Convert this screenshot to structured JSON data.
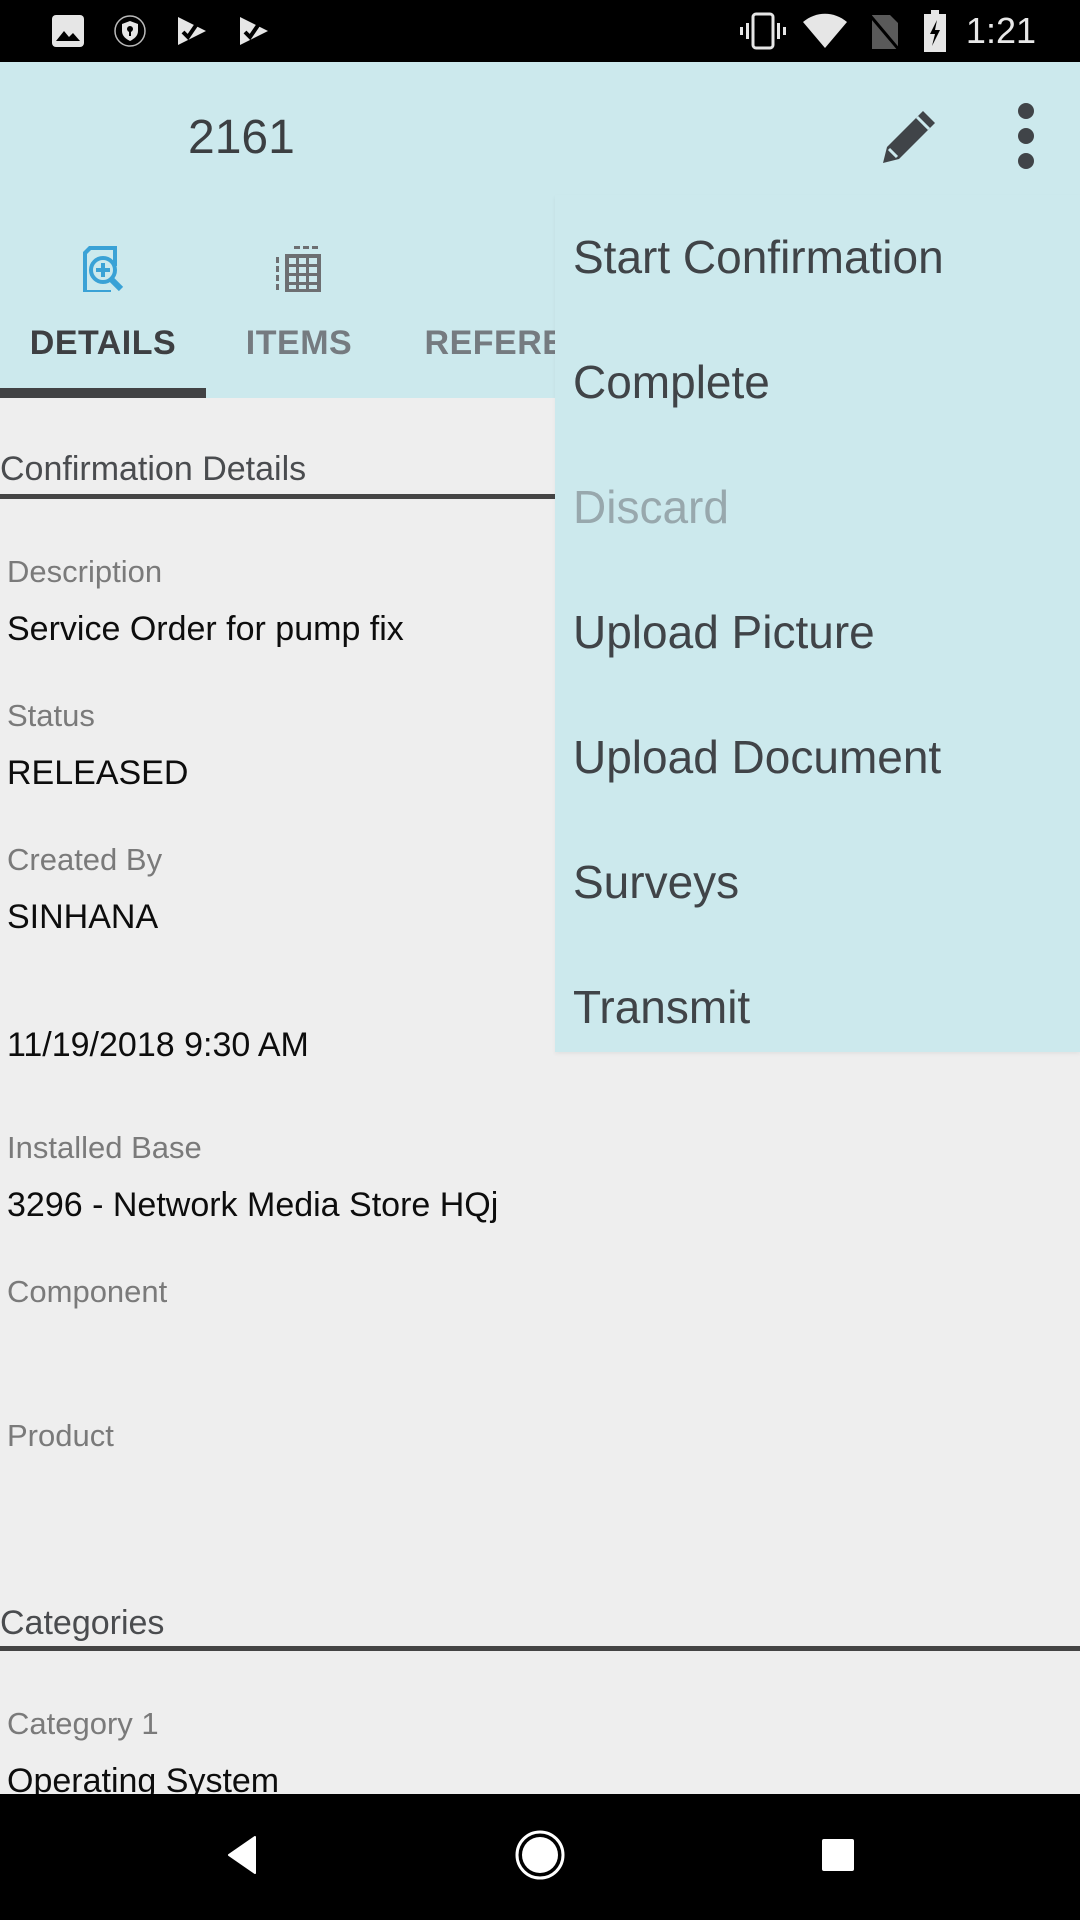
{
  "status_bar": {
    "time": "1:21",
    "left_icons": [
      "image-icon",
      "vpn-shield-icon",
      "play-store-check-icon",
      "play-store-check-icon"
    ],
    "right_icons": [
      "vibrate-icon",
      "wifi-icon",
      "no-sim-icon",
      "battery-charging-icon"
    ]
  },
  "toolbar": {
    "title": "2161",
    "edit_icon": "pencil-icon",
    "more_icon": "more-vert-icon"
  },
  "tabs": [
    {
      "label": "DETAILS",
      "icon": "document-search-icon",
      "active": true
    },
    {
      "label": "ITEMS",
      "icon": "grid-list-icon",
      "active": false
    },
    {
      "label": "REFERE",
      "icon": "",
      "active": false
    }
  ],
  "colors": {
    "toolbar_bg": "#cce9ed",
    "content_bg": "#eeeeee",
    "active_icon": "#3aa2d6",
    "tab_indicator": "#414244",
    "disabled_menu_text": "#98a8ad"
  },
  "details": {
    "section_title": "Confirmation Details",
    "fields": [
      {
        "label": "Description",
        "value": "Service Order for pump fix"
      },
      {
        "label": "Status",
        "value": "RELEASED"
      },
      {
        "label": "Created By",
        "value": "SINHANA"
      },
      {
        "label": "",
        "value": "11/19/2018 9:30 AM"
      },
      {
        "label": "Installed Base",
        "value": "3296 - Network Media Store HQj"
      },
      {
        "label": "Component",
        "value": ""
      },
      {
        "label": "Product",
        "value": ""
      }
    ]
  },
  "categories": {
    "section_title": "Categories",
    "fields": [
      {
        "label": "Category 1",
        "value": "Operating System"
      }
    ]
  },
  "overflow_menu": {
    "items": [
      {
        "label": "Start Confirmation",
        "enabled": true
      },
      {
        "label": "Complete",
        "enabled": true
      },
      {
        "label": "Discard",
        "enabled": false
      },
      {
        "label": "Upload Picture",
        "enabled": true
      },
      {
        "label": "Upload Document",
        "enabled": true
      },
      {
        "label": "Surveys",
        "enabled": true
      },
      {
        "label": "Transmit",
        "enabled": true
      }
    ]
  },
  "nav_bar": {
    "buttons": [
      "back-icon",
      "home-icon",
      "recents-icon"
    ]
  }
}
